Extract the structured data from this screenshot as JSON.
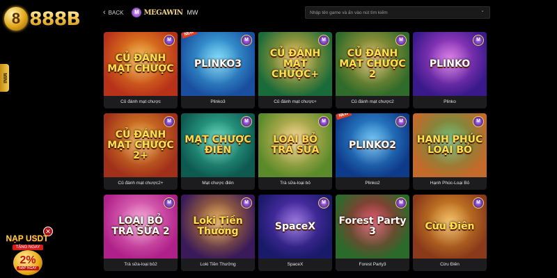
{
  "brand": {
    "logo_text": "888B"
  },
  "side_tab": {
    "label": "MINI"
  },
  "promo": {
    "title": "NẠP USDT",
    "subtitle": "TẶNG NGAY",
    "percent": "2%",
    "button": "NẠP NGAY",
    "close": "✕"
  },
  "topbar": {
    "back_label": "BACK",
    "provider_mark": "M",
    "provider_name": "MEGAWIN",
    "provider_code": "MW",
    "search_placeholder": "Nhập tên game và ấn vào nút tìm kiếm"
  },
  "games": [
    {
      "title": "Củ đánh mạt chược",
      "art": "CỦ ĐÁNH MẠT CHƯỢC",
      "new": false,
      "bg": "#b8321a",
      "bg2": "#f0a020",
      "text": "#ffe04a"
    },
    {
      "title": "Plinko3",
      "art": "PLINKO3",
      "new": true,
      "bg": "#1a4fa0",
      "bg2": "#4cc6f0",
      "text": "#ffffff"
    },
    {
      "title": "Củ đánh mạt chược+",
      "art": "CỦ ĐÁNH MẠT CHƯỢC+",
      "new": false,
      "bg": "#1a6b3a",
      "bg2": "#e9b33a",
      "text": "#ffe04a"
    },
    {
      "title": "Củ đánh mạt chược2",
      "art": "CỦ ĐÁNH MẠT CHƯỢC 2",
      "new": false,
      "bg": "#2f6b2a",
      "bg2": "#c8a640",
      "text": "#ffe04a"
    },
    {
      "title": "Plinko",
      "art": "PLINKO",
      "new": false,
      "bg": "#3a1a8a",
      "bg2": "#c44ad8",
      "text": "#ffffff"
    },
    {
      "title": "Củ đánh mạt chược2+",
      "art": "CỦ ĐÁNH MẠT CHƯỢC 2+",
      "new": false,
      "bg": "#a0301a",
      "bg2": "#e89a28",
      "text": "#ffe04a"
    },
    {
      "title": "Mạt chược điên",
      "art": "MẠT CHƯỢC ĐIÊN",
      "new": false,
      "bg": "#0e5a50",
      "bg2": "#3bc6a6",
      "text": "#ffd84a"
    },
    {
      "title": "Trà sữa-loại bỏ",
      "art": "LOẠI BỎ TRÀ SỮA",
      "new": false,
      "bg": "#5a8a2a",
      "bg2": "#f0c46a",
      "text": "#ffd84a"
    },
    {
      "title": "Plinko2",
      "art": "PLINKO2",
      "new": true,
      "bg": "#0e3a8a",
      "bg2": "#3aa6e8",
      "text": "#ffffff"
    },
    {
      "title": "Hạnh Phúc-Loại Bỏ",
      "art": "HẠNH PHÚC LOẠI BỎ",
      "new": false,
      "bg": "#c46a2a",
      "bg2": "#4aa04a",
      "text": "#ffe04a"
    },
    {
      "title": "Trà sữa-loại bỏ2",
      "art": "LOẠI BỎ TRÀ SỮA 2",
      "new": false,
      "bg": "#b0208a",
      "bg2": "#f08ac8",
      "text": "#ffffff"
    },
    {
      "title": "Loki Tiền Thưởng",
      "art": "Loki Tiền Thưởng",
      "new": false,
      "bg": "#3a1a5a",
      "bg2": "#d8902a",
      "text": "#ffe04a"
    },
    {
      "title": "SpaceX",
      "art": "SpaceX",
      "new": false,
      "bg": "#1a1a6a",
      "bg2": "#6a3ac8",
      "text": "#ffffff"
    },
    {
      "title": "Forest Party3",
      "art": "Forest Party 3",
      "new": false,
      "bg": "#2a6a2a",
      "bg2": "#c8203a",
      "text": "#ffffff"
    },
    {
      "title": "Cừu Điên",
      "art": "Cừu Điên",
      "new": false,
      "bg": "#8a3a1a",
      "bg2": "#e8a02a",
      "text": "#ffe04a"
    }
  ],
  "badge_label": "M",
  "new_label": "NEW"
}
